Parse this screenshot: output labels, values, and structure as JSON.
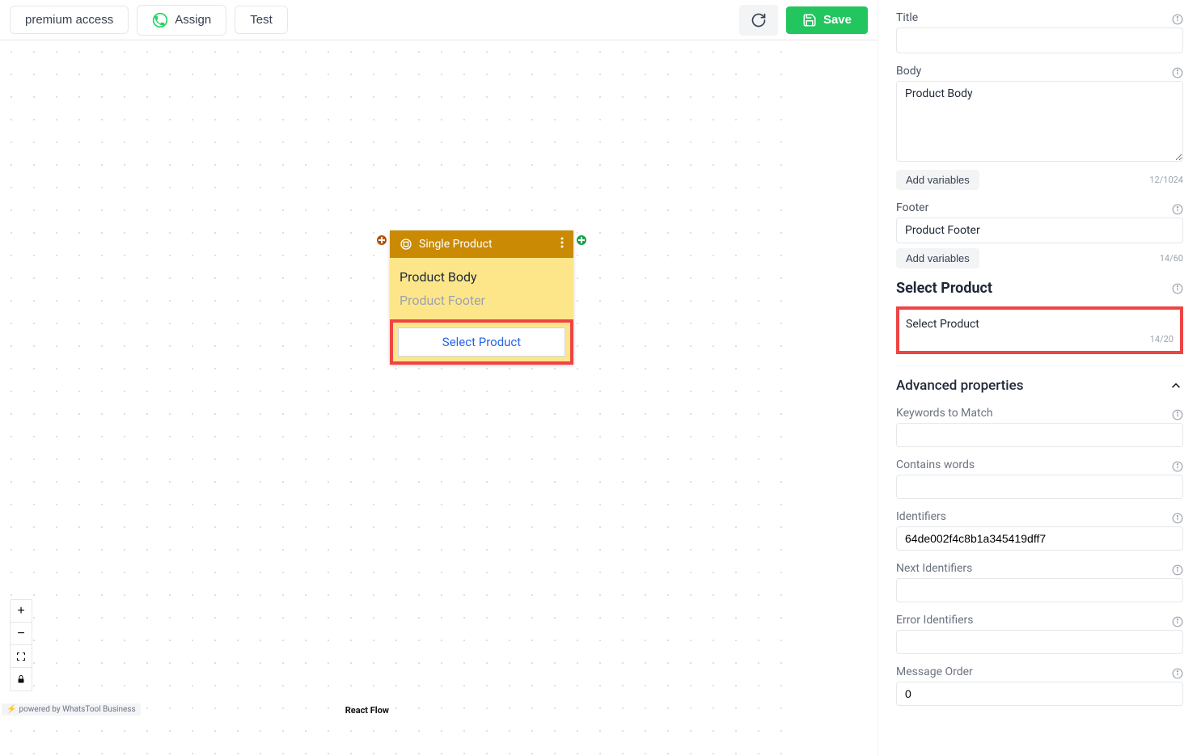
{
  "topbar": {
    "premium_label": "premium access",
    "assign_label": "Assign",
    "test_label": "Test",
    "save_label": "Save"
  },
  "node": {
    "title": "Single Product",
    "body_text": "Product Body",
    "footer_text": "Product Footer",
    "select_button": "Select Product"
  },
  "panel": {
    "title_label": "Title",
    "title_value": "",
    "body_label": "Body",
    "body_value": "Product Body",
    "body_counter": "12/1024",
    "add_variables": "Add variables",
    "footer_label": "Footer",
    "footer_value": "Product Footer",
    "footer_counter": "14/60",
    "select_product_header": "Select Product",
    "select_product_value": "Select Product",
    "select_product_counter": "14/20",
    "advanced_header": "Advanced properties",
    "keywords_label": "Keywords to Match",
    "keywords_value": "",
    "contains_label": "Contains words",
    "contains_value": "",
    "identifiers_label": "Identifiers",
    "identifiers_value": "64de002f4c8b1a345419dff7",
    "next_identifiers_label": "Next Identifiers",
    "next_identifiers_value": "",
    "error_identifiers_label": "Error Identifiers",
    "error_identifiers_value": "",
    "message_order_label": "Message Order",
    "message_order_value": "0"
  },
  "attribution": {
    "powered": "powered by WhatsTool Business",
    "react_flow": "React Flow"
  }
}
